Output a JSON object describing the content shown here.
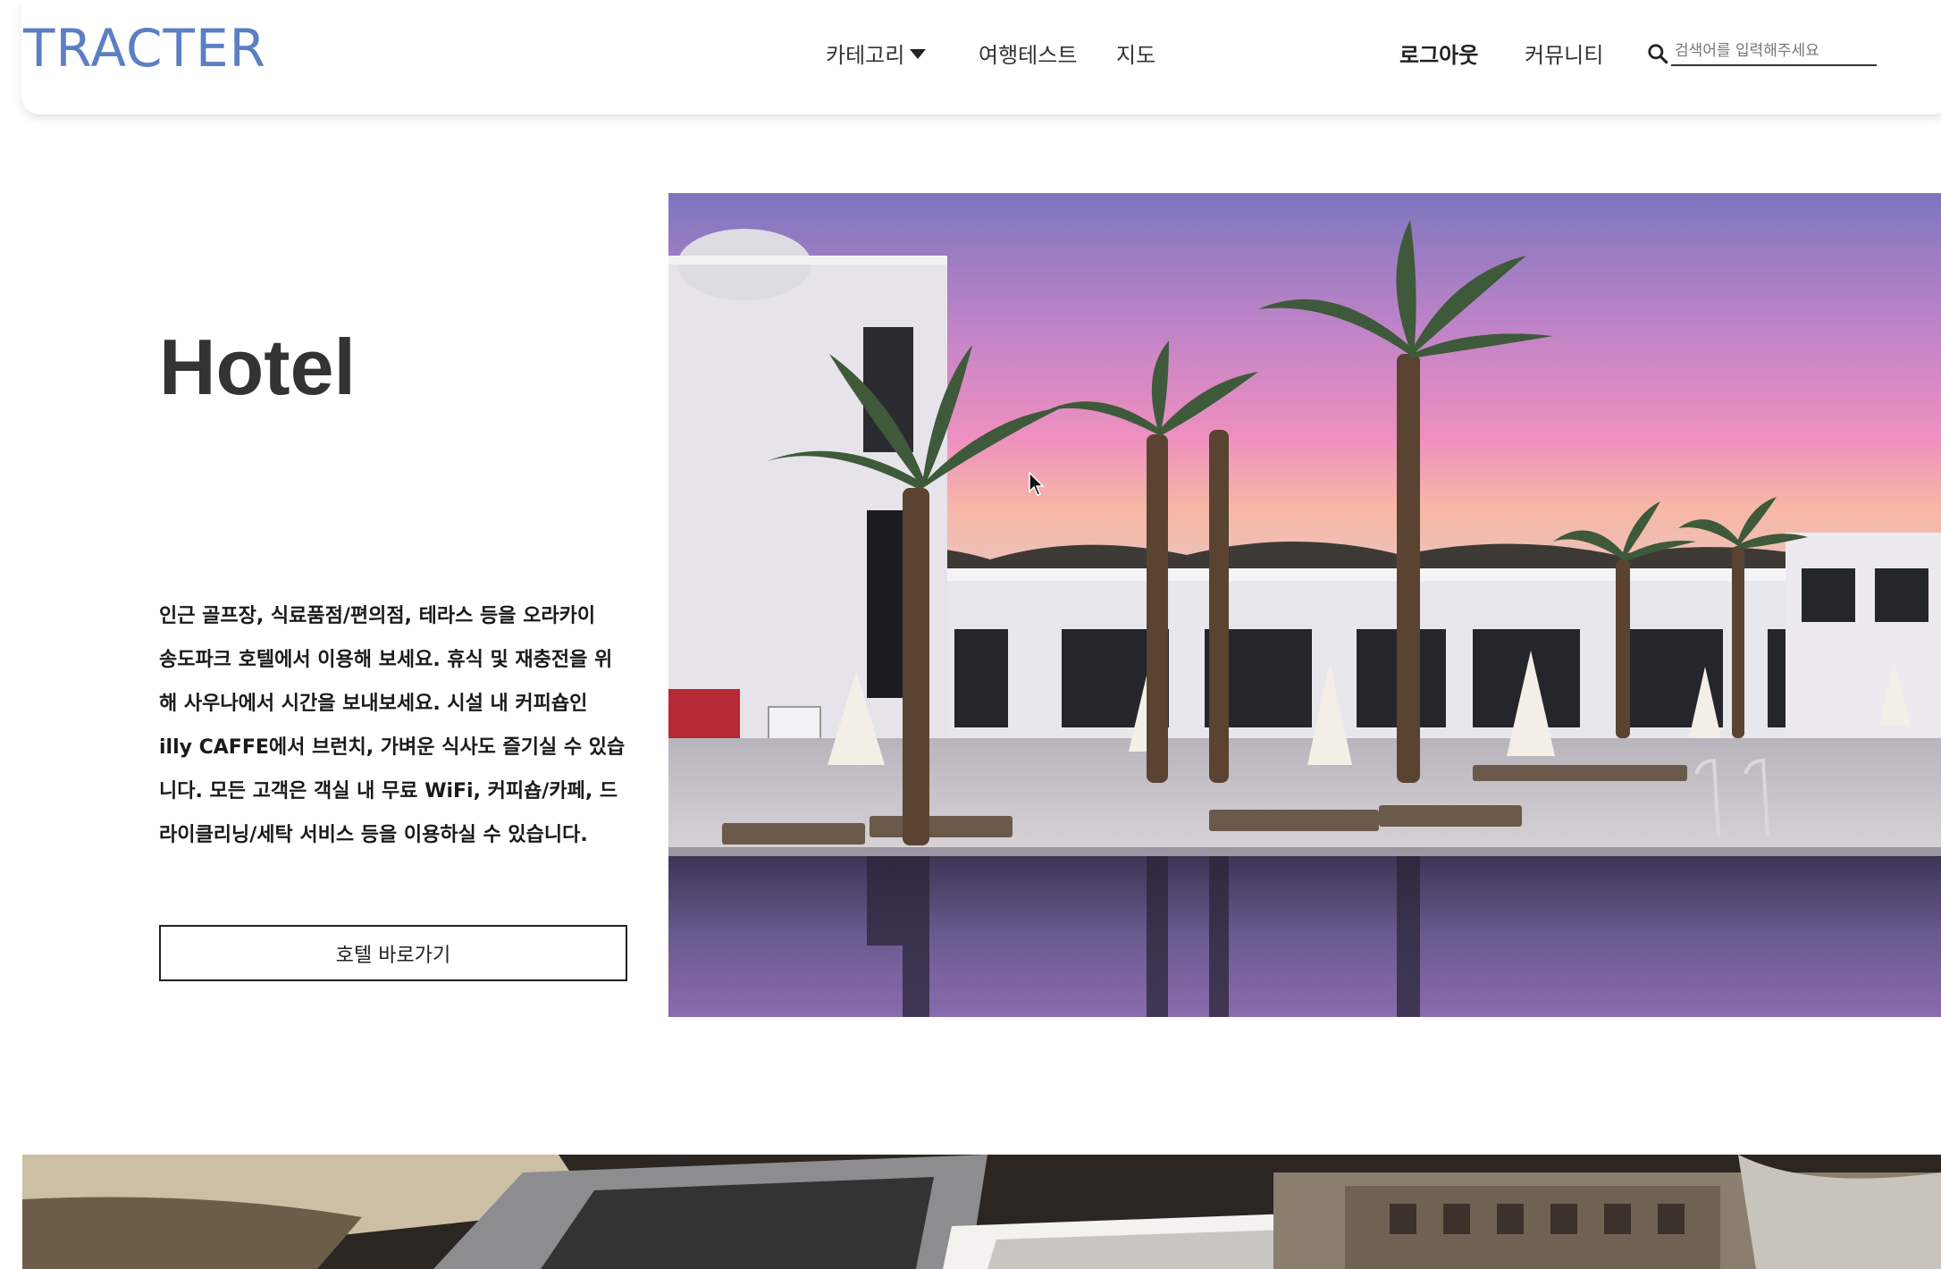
{
  "header": {
    "logo": "TRACTER",
    "nav": {
      "category": "카테고리",
      "travel_test": "여행테스트",
      "map": "지도",
      "logout": "로그아웃",
      "community": "커뮤니티"
    },
    "search": {
      "placeholder": "검색어를 입력해주세요",
      "icon": "search-icon"
    }
  },
  "hero": {
    "title": "Hotel",
    "description_lines": [
      "인근 골프장, 식료품점/편의점, 테라스 등을 오라카이",
      "송도파크 호텔에서 이용해 보세요. 휴식 및 재충전을 위",
      "해 사우나에서 시간을 보내보세요. 시설 내 커피숍인",
      "illy CAFFE에서 브런치, 가벼운 식사도 즐기실 수 있습",
      "니다. 모든 고객은 객실 내 무료 WiFi, 커피숍/카페, 드",
      "라이클리닝/세탁 서비스 등을 이용하실 수 있습니다."
    ],
    "button_label": "호텔 바로가기"
  },
  "colors": {
    "logo": "#5b7fc4",
    "text": "#222222",
    "sky_top": "#8a7fc4",
    "sky_glow": "#f28ab8"
  }
}
